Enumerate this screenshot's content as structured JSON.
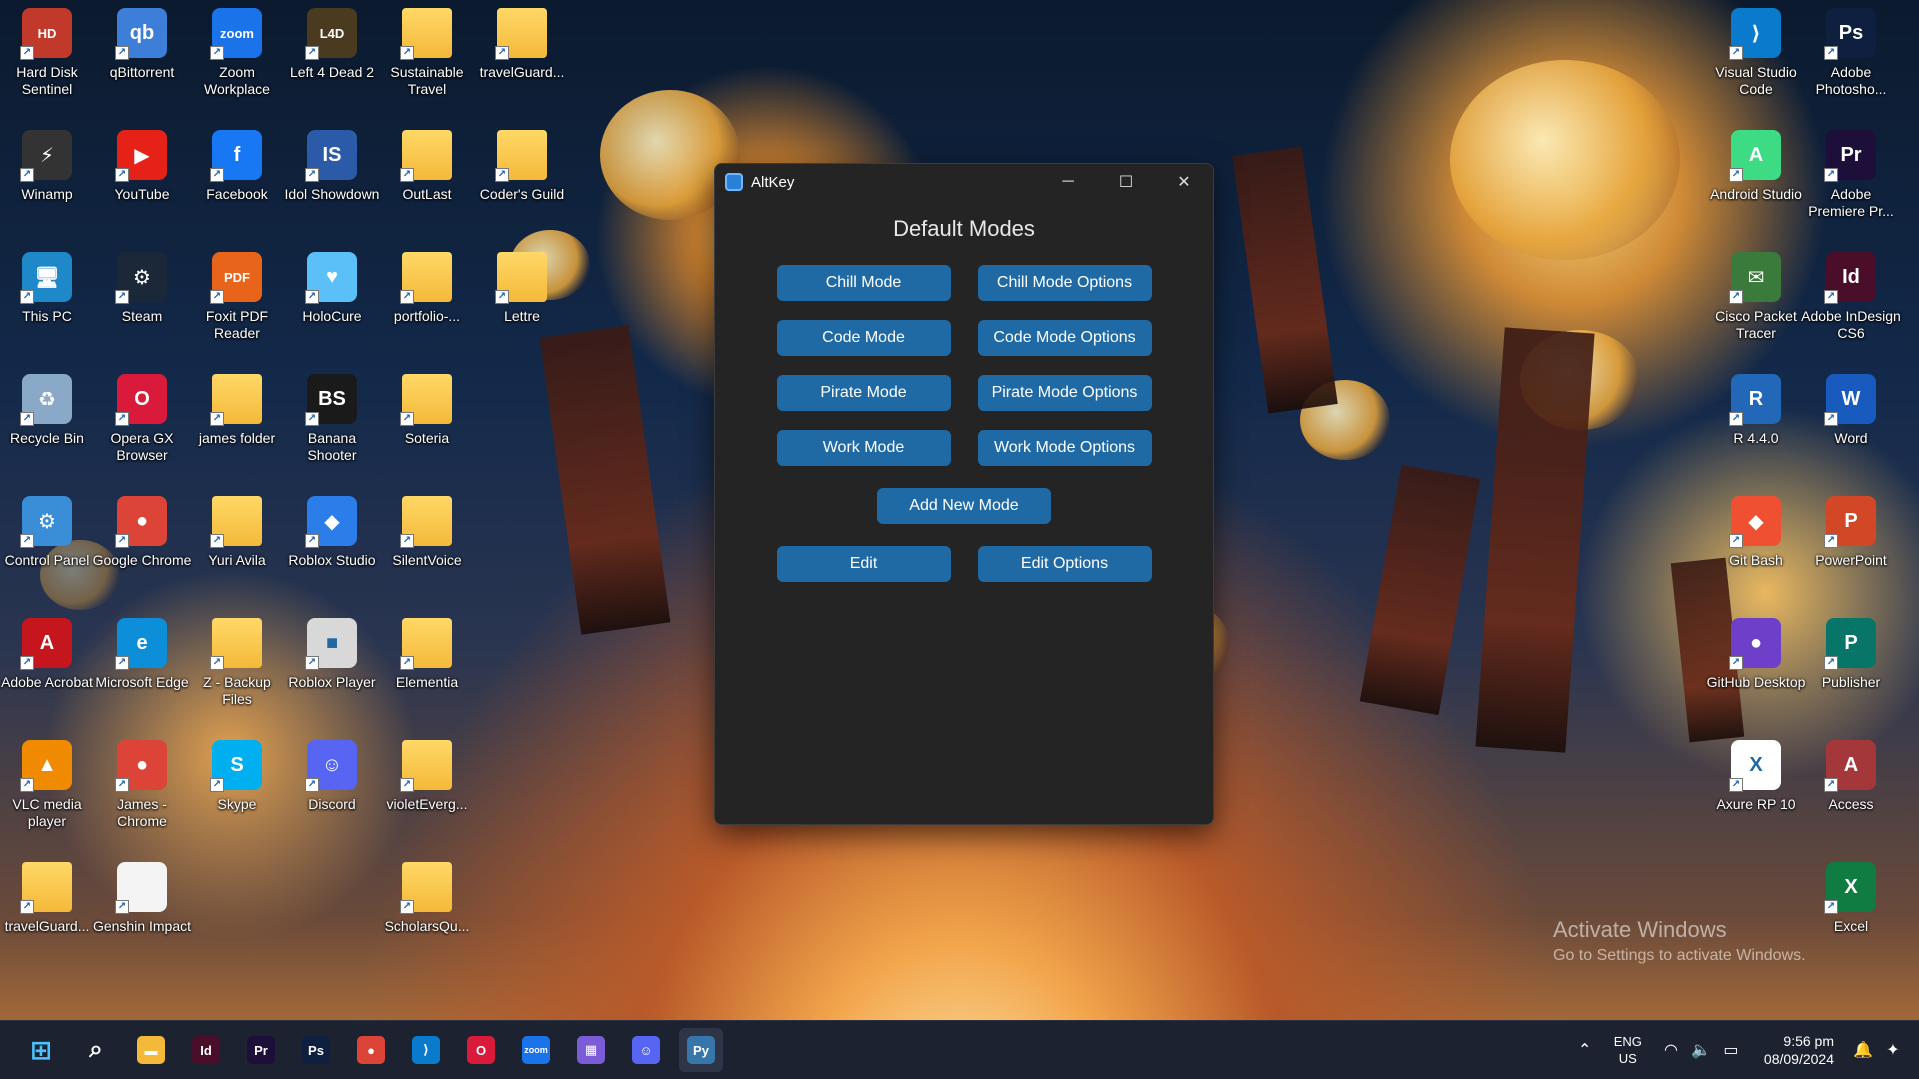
{
  "desktop": {
    "icons_left": [
      {
        "label": "Hard Disk Sentinel",
        "glyph": "HD",
        "color": "#c0392b",
        "icon": "hard-disk-icon"
      },
      {
        "label": "qBittorrent",
        "glyph": "qb",
        "color": "#3d7ed9",
        "icon": "qbittorrent-icon"
      },
      {
        "label": "Zoom Workplace",
        "glyph": "zoom",
        "color": "#1a73e8",
        "icon": "zoom-icon"
      },
      {
        "label": "Left 4 Dead 2",
        "glyph": "L4D",
        "color": "#4a3a20",
        "icon": "left4dead-icon"
      },
      {
        "label": "Sustainable Travel",
        "glyph": "",
        "color": "folder",
        "icon": "folder-icon"
      },
      {
        "label": "travelGuard...",
        "glyph": "",
        "color": "folder",
        "icon": "folder-icon"
      },
      {
        "label": "Winamp",
        "glyph": "⚡",
        "color": "#333",
        "icon": "winamp-icon"
      },
      {
        "label": "YouTube",
        "glyph": "▶",
        "color": "#e62117",
        "icon": "youtube-icon"
      },
      {
        "label": "Facebook",
        "glyph": "f",
        "color": "#1877f2",
        "icon": "facebook-icon"
      },
      {
        "label": "Idol Showdown",
        "glyph": "IS",
        "color": "#2b5aa8",
        "icon": "idol-showdown-icon"
      },
      {
        "label": "OutLast",
        "glyph": "",
        "color": "folder",
        "icon": "folder-icon"
      },
      {
        "label": "Coder's Guild",
        "glyph": "",
        "color": "folder",
        "icon": "folder-icon"
      },
      {
        "label": "This PC",
        "glyph": "🖥",
        "color": "#1e88c8",
        "icon": "this-pc-icon"
      },
      {
        "label": "Steam",
        "glyph": "⚙",
        "color": "#1b2838",
        "icon": "steam-icon"
      },
      {
        "label": "Foxit PDF Reader",
        "glyph": "PDF",
        "color": "#e8641b",
        "icon": "foxit-icon"
      },
      {
        "label": "HoloCure",
        "glyph": "♥",
        "color": "#5bc0f8",
        "icon": "holocure-icon"
      },
      {
        "label": "portfolio-...",
        "glyph": "",
        "color": "folder",
        "icon": "folder-icon"
      },
      {
        "label": "Lettre",
        "glyph": "",
        "color": "folder",
        "icon": "folder-icon"
      },
      {
        "label": "Recycle Bin",
        "glyph": "♻",
        "color": "#8aa9c8",
        "icon": "recycle-bin-icon"
      },
      {
        "label": "Opera GX Browser",
        "glyph": "O",
        "color": "#d91a3a",
        "icon": "opera-gx-icon"
      },
      {
        "label": "james folder",
        "glyph": "",
        "color": "folder",
        "icon": "folder-icon"
      },
      {
        "label": "Banana Shooter",
        "glyph": "BS",
        "color": "#1a1a1a",
        "icon": "banana-shooter-icon"
      },
      {
        "label": "Soteria",
        "glyph": "",
        "color": "folder",
        "icon": "folder-icon"
      },
      {
        "label": "",
        "glyph": "",
        "color": "none",
        "icon": "blank"
      },
      {
        "label": "Control Panel",
        "glyph": "⚙",
        "color": "#3a8ed8",
        "icon": "control-panel-icon"
      },
      {
        "label": "Google Chrome",
        "glyph": "●",
        "color": "#db4437",
        "icon": "chrome-icon"
      },
      {
        "label": "Yuri Avila",
        "glyph": "",
        "color": "folder",
        "icon": "folder-icon"
      },
      {
        "label": "Roblox Studio",
        "glyph": "◆",
        "color": "#2b7de9",
        "icon": "roblox-studio-icon"
      },
      {
        "label": "SilentVoice",
        "glyph": "",
        "color": "folder",
        "icon": "folder-icon"
      },
      {
        "label": "",
        "glyph": "",
        "color": "none",
        "icon": "blank"
      },
      {
        "label": "Adobe Acrobat",
        "glyph": "A",
        "color": "#c4161c",
        "icon": "acrobat-icon"
      },
      {
        "label": "Microsoft Edge",
        "glyph": "e",
        "color": "#0c8ed9",
        "icon": "edge-icon"
      },
      {
        "label": "Z - Backup Files",
        "glyph": "",
        "color": "folder",
        "icon": "folder-icon"
      },
      {
        "label": "Roblox Player",
        "glyph": "■",
        "color": "#d8d8d8",
        "icon": "roblox-player-icon"
      },
      {
        "label": "Elementia",
        "glyph": "",
        "color": "folder",
        "icon": "folder-icon"
      },
      {
        "label": "",
        "glyph": "",
        "color": "none",
        "icon": "blank"
      },
      {
        "label": "VLC media player",
        "glyph": "▲",
        "color": "#f08a00",
        "icon": "vlc-icon"
      },
      {
        "label": "James - Chrome",
        "glyph": "●",
        "color": "#db4437",
        "icon": "chrome-profile-icon"
      },
      {
        "label": "Skype",
        "glyph": "S",
        "color": "#00aff0",
        "icon": "skype-icon"
      },
      {
        "label": "Discord",
        "glyph": "☺",
        "color": "#5865f2",
        "icon": "discord-icon"
      },
      {
        "label": "violetEverg...",
        "glyph": "",
        "color": "folder",
        "icon": "folder-icon"
      },
      {
        "label": "",
        "glyph": "",
        "color": "none",
        "icon": "blank"
      },
      {
        "label": "travelGuard...",
        "glyph": "",
        "color": "folder",
        "icon": "folder-icon"
      },
      {
        "label": "Genshin Impact",
        "glyph": "",
        "color": "#f4f4f4",
        "icon": "file-icon"
      },
      {
        "label": "",
        "glyph": "",
        "color": "none",
        "icon": "blank"
      },
      {
        "label": "",
        "glyph": "",
        "color": "none",
        "icon": "blank"
      },
      {
        "label": "ScholarsQu...",
        "glyph": "",
        "color": "folder",
        "icon": "folder-icon"
      }
    ],
    "icons_right": [
      {
        "label": "Visual Studio Code",
        "glyph": "⟩",
        "color": "#0a7acc",
        "icon": "vscode-icon"
      },
      {
        "label": "Adobe Photosho...",
        "glyph": "Ps",
        "color": "#0e1f3f",
        "icon": "photoshop-icon"
      },
      {
        "label": "Android Studio",
        "glyph": "A",
        "color": "#3ddc84",
        "icon": "android-studio-icon"
      },
      {
        "label": "Adobe Premiere Pr...",
        "glyph": "Pr",
        "color": "#1d0f3a",
        "icon": "premiere-icon"
      },
      {
        "label": "Cisco Packet Tracer",
        "glyph": "✉",
        "color": "#3a7a3a",
        "icon": "packet-tracer-icon"
      },
      {
        "label": "Adobe InDesign CS6",
        "glyph": "Id",
        "color": "#4a0d2a",
        "icon": "indesign-icon"
      },
      {
        "label": "R 4.4.0",
        "glyph": "R",
        "color": "#2267b8",
        "icon": "r-icon"
      },
      {
        "label": "Word",
        "glyph": "W",
        "color": "#185abd",
        "icon": "word-icon"
      },
      {
        "label": "Git Bash",
        "glyph": "◆",
        "color": "#f05032",
        "icon": "git-bash-icon"
      },
      {
        "label": "PowerPoint",
        "glyph": "P",
        "color": "#d24726",
        "icon": "powerpoint-icon"
      },
      {
        "label": "GitHub Desktop",
        "glyph": "●",
        "color": "#6e40c9",
        "icon": "github-desktop-icon"
      },
      {
        "label": "Publisher",
        "glyph": "P",
        "color": "#077568",
        "icon": "publisher-icon"
      },
      {
        "label": "Axure RP 10",
        "glyph": "X",
        "color": "#ffffff",
        "icon": "axure-icon"
      },
      {
        "label": "Access",
        "glyph": "A",
        "color": "#a4373a",
        "icon": "access-icon"
      },
      {
        "label": "",
        "glyph": "",
        "color": "none",
        "icon": "blank"
      },
      {
        "label": "Excel",
        "glyph": "X",
        "color": "#107c41",
        "icon": "excel-icon"
      }
    ]
  },
  "window": {
    "title": "AltKey",
    "heading": "Default Modes",
    "buttons": [
      {
        "label": "Chill Mode",
        "name": "chill-mode-button"
      },
      {
        "label": "Chill Mode Options",
        "name": "chill-mode-options-button"
      },
      {
        "label": "Code Mode",
        "name": "code-mode-button"
      },
      {
        "label": "Code Mode Options",
        "name": "code-mode-options-button"
      },
      {
        "label": "Pirate Mode",
        "name": "pirate-mode-button"
      },
      {
        "label": "Pirate Mode Options",
        "name": "pirate-mode-options-button"
      },
      {
        "label": "Work Mode",
        "name": "work-mode-button"
      },
      {
        "label": "Work Mode Options",
        "name": "work-mode-options-button"
      }
    ],
    "add_label": "Add New Mode",
    "edit_label": "Edit",
    "edit_options_label": "Edit Options",
    "accent": "#1f6aa5"
  },
  "watermark": {
    "line1": "Activate Windows",
    "line2": "Go to Settings to activate Windows."
  },
  "taskbar": {
    "apps": [
      {
        "name": "start-button",
        "glyph": "⊞",
        "color": "#4cc2ff"
      },
      {
        "name": "search-button",
        "glyph": "⌕",
        "color": "transparent"
      },
      {
        "name": "file-explorer-taskbar",
        "glyph": "▬",
        "color": "#f4b93a"
      },
      {
        "name": "indesign-taskbar",
        "glyph": "Id",
        "color": "#4a0d2a"
      },
      {
        "name": "premiere-taskbar",
        "glyph": "Pr",
        "color": "#1d0f3a"
      },
      {
        "name": "photoshop-taskbar",
        "glyph": "Ps",
        "color": "#0e1f3f"
      },
      {
        "name": "chrome-taskbar",
        "glyph": "●",
        "color": "#db4437"
      },
      {
        "name": "vscode-taskbar",
        "glyph": "⟩",
        "color": "#0a7acc"
      },
      {
        "name": "opera-taskbar",
        "glyph": "O",
        "color": "#d91a3a"
      },
      {
        "name": "zoom-taskbar",
        "glyph": "zoom",
        "color": "#1a73e8"
      },
      {
        "name": "clipchamp-taskbar",
        "glyph": "▦",
        "color": "#7b5cd6"
      },
      {
        "name": "discord-taskbar",
        "glyph": "☺",
        "color": "#5865f2"
      },
      {
        "name": "python-taskbar",
        "glyph": "Py",
        "color": "#3776ab"
      }
    ],
    "lang_top": "ENG",
    "lang_bottom": "US",
    "time": "9:56 pm",
    "date": "08/09/2024"
  }
}
